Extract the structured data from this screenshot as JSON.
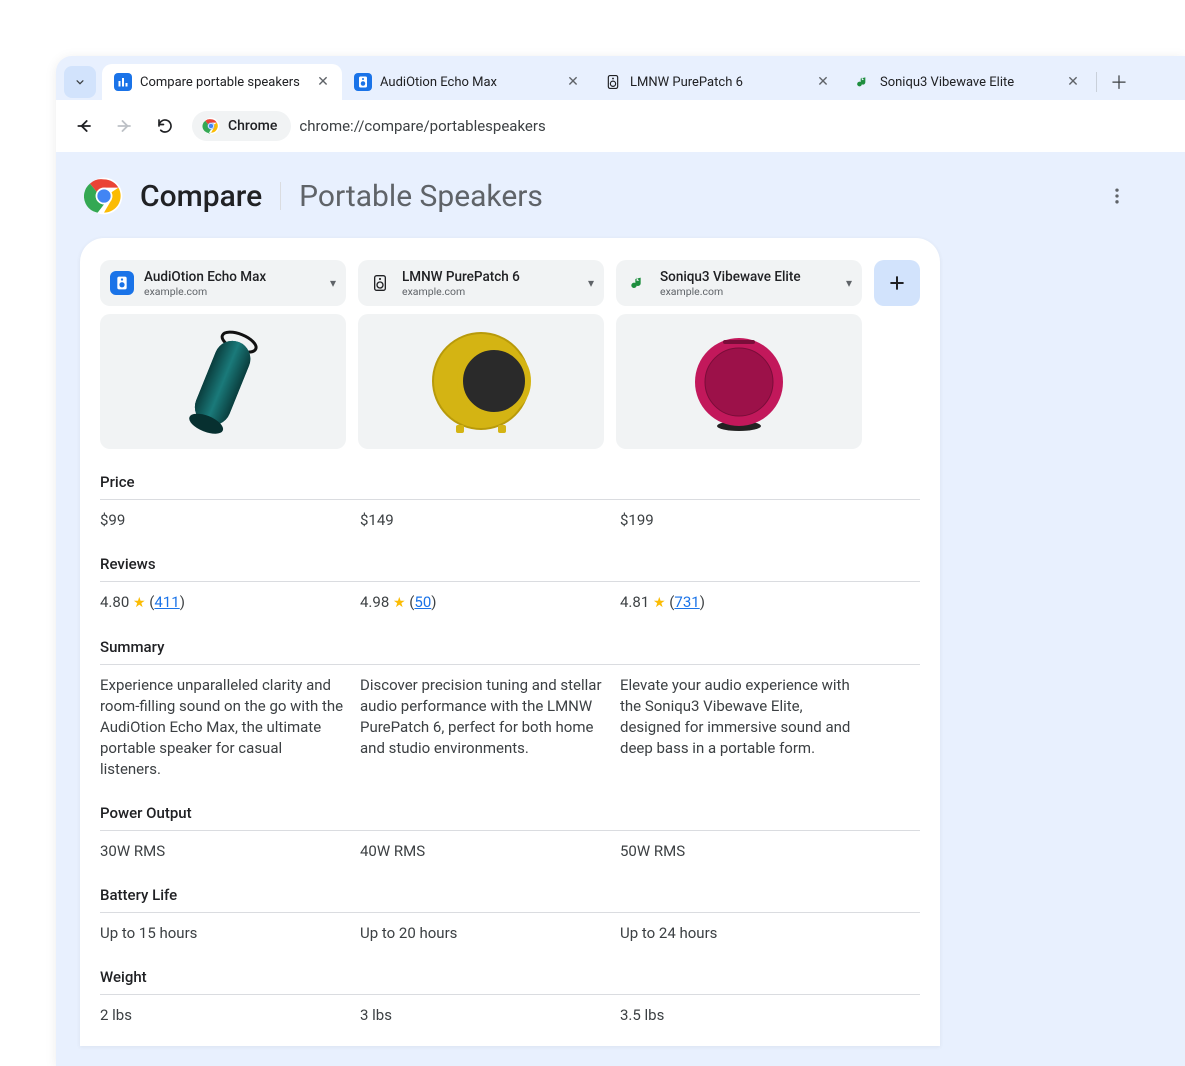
{
  "tabs": [
    {
      "title": "Compare portable speakers"
    },
    {
      "title": "AudiOtion Echo Max"
    },
    {
      "title": "LMNW PurePatch 6"
    },
    {
      "title": "Soniqu3 Vibewave Elite"
    }
  ],
  "omnibox": {
    "chip_label": "Chrome",
    "url": "chrome://compare/portablespeakers"
  },
  "page": {
    "title": "Compare",
    "subtitle": "Portable Speakers"
  },
  "products": [
    {
      "name": "AudiOtion Echo Max",
      "domain": "example.com"
    },
    {
      "name": "LMNW PurePatch 6",
      "domain": "example.com"
    },
    {
      "name": "Soniqu3 Vibewave Elite",
      "domain": "example.com"
    }
  ],
  "rows": {
    "price": {
      "label": "Price",
      "values": [
        "$99",
        "$149",
        "$199"
      ]
    },
    "reviews": {
      "label": "Reviews",
      "scores": [
        "4.80",
        "4.98",
        "4.81"
      ],
      "counts": [
        "411",
        "50",
        "731"
      ]
    },
    "summary": {
      "label": "Summary",
      "values": [
        "Experience unparalleled clarity and room-filling sound on the go with the AudiOtion Echo Max, the ultimate portable speaker for casual listeners.",
        "Discover precision tuning and stellar audio performance with the LMNW PurePatch 6, perfect for both home and studio environments.",
        "Elevate your audio experience with the Soniqu3 Vibewave Elite, designed for immersive sound and deep bass in a portable form."
      ]
    },
    "power": {
      "label": "Power Output",
      "values": [
        "30W RMS",
        "40W RMS",
        "50W RMS"
      ]
    },
    "battery": {
      "label": "Battery Life",
      "values": [
        "Up to 15 hours",
        "Up to 20 hours",
        "Up to 24 hours"
      ]
    },
    "weight": {
      "label": "Weight",
      "values": [
        "2 lbs",
        "3 lbs",
        "3.5 lbs"
      ]
    }
  }
}
